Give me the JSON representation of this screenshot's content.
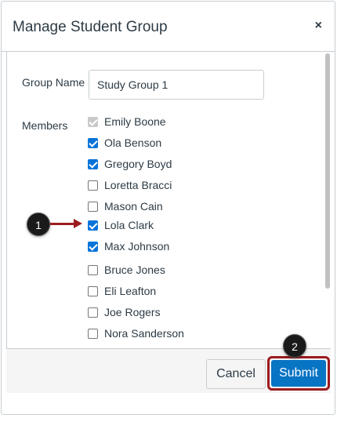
{
  "dialog": {
    "title": "Manage Student Group",
    "close_glyph": "×"
  },
  "form": {
    "group_name_label": "Group Name",
    "group_name_value": "Study Group 1",
    "members_label": "Members"
  },
  "members": [
    {
      "name": "Emily Boone",
      "checked": true,
      "disabled": true
    },
    {
      "name": "Ola Benson",
      "checked": true,
      "disabled": false
    },
    {
      "name": "Gregory Boyd",
      "checked": true,
      "disabled": false
    },
    {
      "name": "Loretta Bracci",
      "checked": false,
      "disabled": false
    },
    {
      "name": "Mason Cain",
      "checked": false,
      "disabled": false
    },
    {
      "name": "Lola Clark",
      "checked": true,
      "disabled": false
    },
    {
      "name": "Max Johnson",
      "checked": true,
      "disabled": false
    },
    {
      "name": "Bruce Jones",
      "checked": false,
      "disabled": false
    },
    {
      "name": "Eli Leafton",
      "checked": false,
      "disabled": false
    },
    {
      "name": "Joe Rogers",
      "checked": false,
      "disabled": false
    },
    {
      "name": "Nora Sanderson",
      "checked": false,
      "disabled": false
    }
  ],
  "footer": {
    "cancel_label": "Cancel",
    "submit_label": "Submit"
  },
  "callouts": {
    "step1": "1",
    "step2": "2"
  },
  "colors": {
    "accent": "#0874c4",
    "callout_red": "#9b1b1f"
  }
}
